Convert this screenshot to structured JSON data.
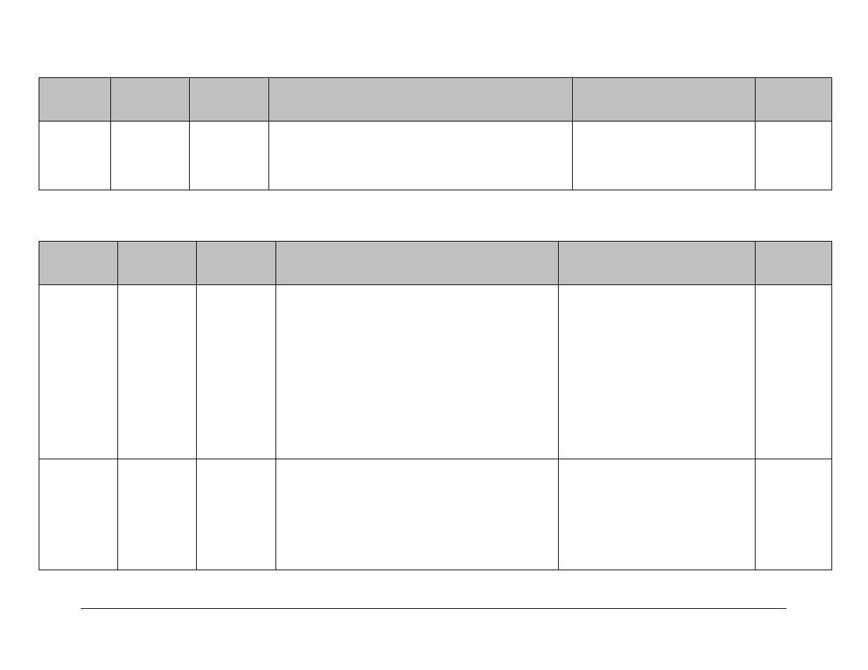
{
  "table1": {
    "headers": [
      "",
      "",
      "",
      "",
      "",
      ""
    ],
    "rows": [
      [
        "",
        "",
        "",
        "",
        "",
        ""
      ]
    ]
  },
  "table2": {
    "headers": [
      "",
      "",
      "",
      "",
      "",
      ""
    ],
    "rows": [
      [
        "",
        "",
        "",
        "",
        "",
        ""
      ],
      [
        "",
        "",
        "",
        "",
        "",
        ""
      ]
    ]
  }
}
